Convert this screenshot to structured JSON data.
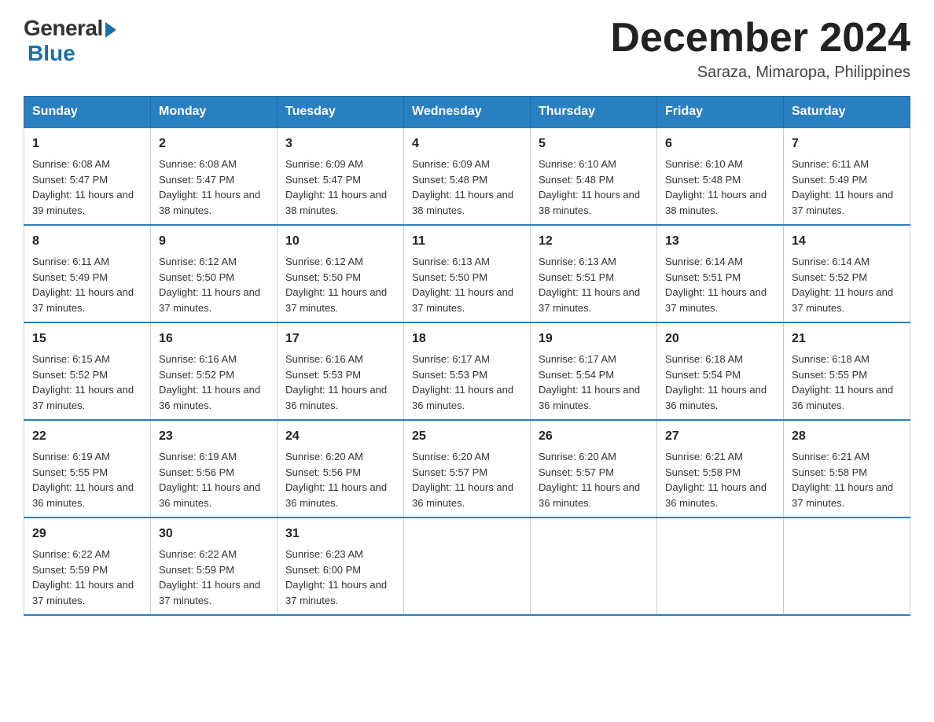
{
  "header": {
    "logo_general": "General",
    "logo_blue": "Blue",
    "title_month": "December 2024",
    "title_location": "Saraza, Mimaropa, Philippines"
  },
  "days_of_week": [
    "Sunday",
    "Monday",
    "Tuesday",
    "Wednesday",
    "Thursday",
    "Friday",
    "Saturday"
  ],
  "weeks": [
    [
      {
        "day": "1",
        "sunrise": "6:08 AM",
        "sunset": "5:47 PM",
        "daylight": "11 hours and 39 minutes."
      },
      {
        "day": "2",
        "sunrise": "6:08 AM",
        "sunset": "5:47 PM",
        "daylight": "11 hours and 38 minutes."
      },
      {
        "day": "3",
        "sunrise": "6:09 AM",
        "sunset": "5:47 PM",
        "daylight": "11 hours and 38 minutes."
      },
      {
        "day": "4",
        "sunrise": "6:09 AM",
        "sunset": "5:48 PM",
        "daylight": "11 hours and 38 minutes."
      },
      {
        "day": "5",
        "sunrise": "6:10 AM",
        "sunset": "5:48 PM",
        "daylight": "11 hours and 38 minutes."
      },
      {
        "day": "6",
        "sunrise": "6:10 AM",
        "sunset": "5:48 PM",
        "daylight": "11 hours and 38 minutes."
      },
      {
        "day": "7",
        "sunrise": "6:11 AM",
        "sunset": "5:49 PM",
        "daylight": "11 hours and 37 minutes."
      }
    ],
    [
      {
        "day": "8",
        "sunrise": "6:11 AM",
        "sunset": "5:49 PM",
        "daylight": "11 hours and 37 minutes."
      },
      {
        "day": "9",
        "sunrise": "6:12 AM",
        "sunset": "5:50 PM",
        "daylight": "11 hours and 37 minutes."
      },
      {
        "day": "10",
        "sunrise": "6:12 AM",
        "sunset": "5:50 PM",
        "daylight": "11 hours and 37 minutes."
      },
      {
        "day": "11",
        "sunrise": "6:13 AM",
        "sunset": "5:50 PM",
        "daylight": "11 hours and 37 minutes."
      },
      {
        "day": "12",
        "sunrise": "6:13 AM",
        "sunset": "5:51 PM",
        "daylight": "11 hours and 37 minutes."
      },
      {
        "day": "13",
        "sunrise": "6:14 AM",
        "sunset": "5:51 PM",
        "daylight": "11 hours and 37 minutes."
      },
      {
        "day": "14",
        "sunrise": "6:14 AM",
        "sunset": "5:52 PM",
        "daylight": "11 hours and 37 minutes."
      }
    ],
    [
      {
        "day": "15",
        "sunrise": "6:15 AM",
        "sunset": "5:52 PM",
        "daylight": "11 hours and 37 minutes."
      },
      {
        "day": "16",
        "sunrise": "6:16 AM",
        "sunset": "5:52 PM",
        "daylight": "11 hours and 36 minutes."
      },
      {
        "day": "17",
        "sunrise": "6:16 AM",
        "sunset": "5:53 PM",
        "daylight": "11 hours and 36 minutes."
      },
      {
        "day": "18",
        "sunrise": "6:17 AM",
        "sunset": "5:53 PM",
        "daylight": "11 hours and 36 minutes."
      },
      {
        "day": "19",
        "sunrise": "6:17 AM",
        "sunset": "5:54 PM",
        "daylight": "11 hours and 36 minutes."
      },
      {
        "day": "20",
        "sunrise": "6:18 AM",
        "sunset": "5:54 PM",
        "daylight": "11 hours and 36 minutes."
      },
      {
        "day": "21",
        "sunrise": "6:18 AM",
        "sunset": "5:55 PM",
        "daylight": "11 hours and 36 minutes."
      }
    ],
    [
      {
        "day": "22",
        "sunrise": "6:19 AM",
        "sunset": "5:55 PM",
        "daylight": "11 hours and 36 minutes."
      },
      {
        "day": "23",
        "sunrise": "6:19 AM",
        "sunset": "5:56 PM",
        "daylight": "11 hours and 36 minutes."
      },
      {
        "day": "24",
        "sunrise": "6:20 AM",
        "sunset": "5:56 PM",
        "daylight": "11 hours and 36 minutes."
      },
      {
        "day": "25",
        "sunrise": "6:20 AM",
        "sunset": "5:57 PM",
        "daylight": "11 hours and 36 minutes."
      },
      {
        "day": "26",
        "sunrise": "6:20 AM",
        "sunset": "5:57 PM",
        "daylight": "11 hours and 36 minutes."
      },
      {
        "day": "27",
        "sunrise": "6:21 AM",
        "sunset": "5:58 PM",
        "daylight": "11 hours and 36 minutes."
      },
      {
        "day": "28",
        "sunrise": "6:21 AM",
        "sunset": "5:58 PM",
        "daylight": "11 hours and 37 minutes."
      }
    ],
    [
      {
        "day": "29",
        "sunrise": "6:22 AM",
        "sunset": "5:59 PM",
        "daylight": "11 hours and 37 minutes."
      },
      {
        "day": "30",
        "sunrise": "6:22 AM",
        "sunset": "5:59 PM",
        "daylight": "11 hours and 37 minutes."
      },
      {
        "day": "31",
        "sunrise": "6:23 AM",
        "sunset": "6:00 PM",
        "daylight": "11 hours and 37 minutes."
      },
      null,
      null,
      null,
      null
    ]
  ],
  "labels": {
    "sunrise": "Sunrise:",
    "sunset": "Sunset:",
    "daylight": "Daylight:"
  }
}
